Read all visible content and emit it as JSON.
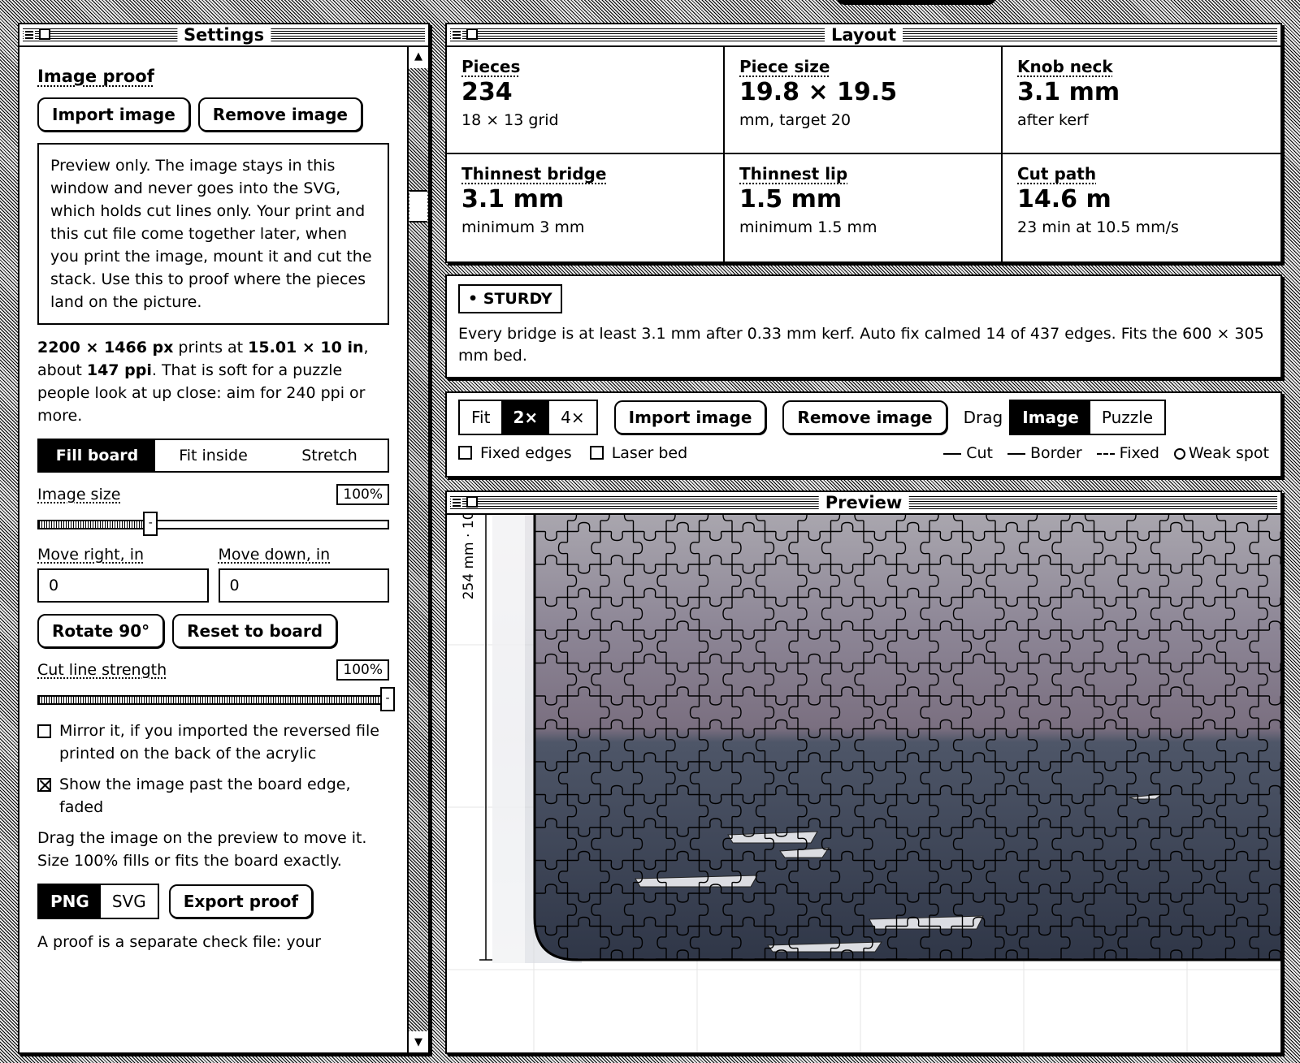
{
  "settings": {
    "title": "Settings",
    "image_proof_heading": "Image proof",
    "import_label": "Import image",
    "remove_label": "Remove image",
    "note": "Preview only. The image stays in this window and never goes into the SVG, which holds cut lines only. Your print and this cut file come together later, when you print the image, mount it and cut the stack. Use this to proof where the pieces land on the picture.",
    "res_px": "2200 × 1466 px",
    "res_mid": " prints at ",
    "res_in": "15.01 × 10 in",
    "res_mid2": ", about ",
    "res_ppi": "147 ppi",
    "res_tail": ". That is soft for a puzzle people look at up close: aim for 240 ppi or more.",
    "fit_modes": [
      "Fill board",
      "Fit inside",
      "Stretch"
    ],
    "fit_selected": "Fill board",
    "image_size_label": "Image size",
    "image_size_value": "100%",
    "image_size_level": 0.32,
    "move_right_label": "Move right, in",
    "move_down_label": "Move down, in",
    "move_right_value": "0",
    "move_down_value": "0",
    "rotate_label": "Rotate 90°",
    "reset_label": "Reset to board",
    "cut_strength_label": "Cut line strength",
    "cut_strength_value": "100%",
    "cut_strength_level": 1.0,
    "mirror_label": "Mirror it, if you imported the reversed file printed on the back of the acrylic",
    "mirror_checked": false,
    "show_past_label": "Show the image past the board edge, faded",
    "show_past_checked": true,
    "drag_hint": "Drag the image on the preview to move it. Size 100% fills or fits the board exactly.",
    "formats": [
      "PNG",
      "SVG"
    ],
    "format_selected": "PNG",
    "export_label": "Export proof",
    "proof_note": "A proof is a separate check file: your"
  },
  "layout": {
    "title": "Layout",
    "stats": [
      {
        "label": "Pieces",
        "value": "234",
        "sub": "18 × 13 grid"
      },
      {
        "label": "Piece size",
        "value": "19.8 × 19.5",
        "sub": "mm, target 20"
      },
      {
        "label": "Knob neck",
        "value": "3.1 mm",
        "sub": "after kerf"
      },
      {
        "label": "Thinnest bridge",
        "value": "3.1 mm",
        "sub": "minimum 3 mm"
      },
      {
        "label": "Thinnest lip",
        "value": "1.5 mm",
        "sub": "minimum 1.5 mm"
      },
      {
        "label": "Cut path",
        "value": "14.6 m",
        "sub": "23 min at 10.5 mm/s"
      }
    ]
  },
  "status": {
    "badge": "• STURDY",
    "message": "Every bridge is at least 3.1 mm after 0.33 mm kerf. Auto fix calmed 14 of 437 edges. Fits the 600 × 305 mm bed."
  },
  "controls": {
    "zoom_options": [
      "Fit",
      "2×",
      "4×"
    ],
    "zoom_selected": "2×",
    "import_label": "Import image",
    "remove_label": "Remove image",
    "drag_label": "Drag",
    "drag_options": [
      "Image",
      "Puzzle"
    ],
    "drag_selected": "Image",
    "fixed_edges_label": "Fixed edges",
    "laser_bed_label": "Laser bed",
    "legend": {
      "cut": "Cut",
      "border": "Border",
      "fixed": "Fixed",
      "weak": "Weak spot"
    }
  },
  "preview": {
    "title": "Preview",
    "ruler_label": "254 mm · 10",
    "sky_color": "#b6aeb6",
    "sea_color": "#3c4658"
  }
}
